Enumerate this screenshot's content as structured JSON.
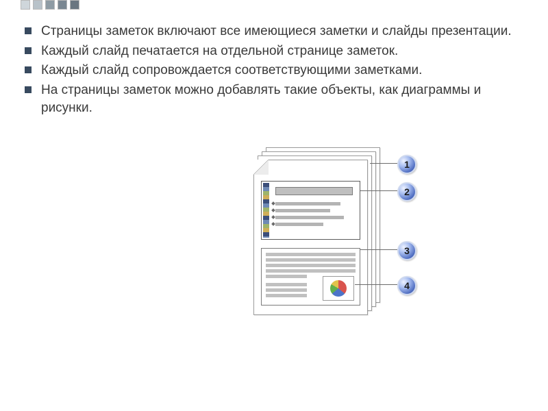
{
  "bullets": [
    " Страницы заметок включают все имеющиеся заметки и слайды презентации.",
    " Каждый слайд печатается на отдельной странице заметок.",
    " Каждый слайд сопровождается соответствующими заметками.",
    " На страницы заметок можно добавлять такие объекты, как диаграммы и рисунки."
  ],
  "callouts": {
    "c1": "1",
    "c2": "2",
    "c3": "3",
    "c4": "4"
  }
}
